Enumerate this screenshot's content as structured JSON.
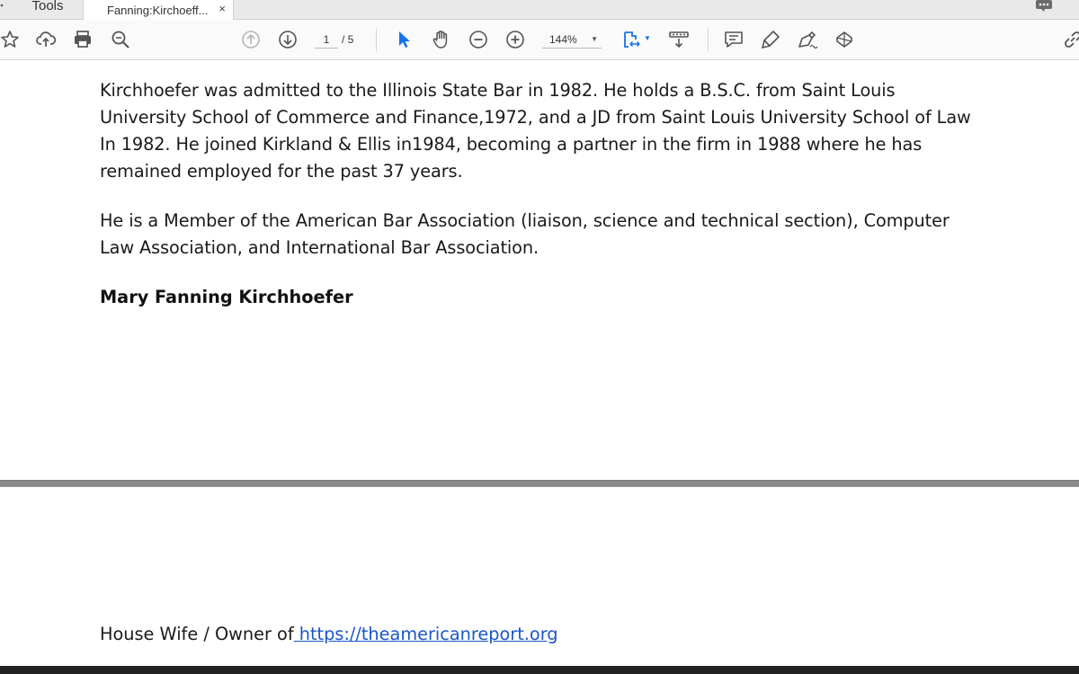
{
  "tabs": {
    "tools_label": "Tools",
    "document_label": "Fanning:Kirchoeff...",
    "close_glyph": "×"
  },
  "toolbar": {
    "icons": [
      "star-icon",
      "cloud-upload-icon",
      "print-icon",
      "search-zoom-icon",
      "page-up-icon",
      "page-down-icon",
      "select-cursor-icon",
      "hand-icon",
      "zoom-out-icon",
      "zoom-in-icon",
      "fit-page-icon",
      "scroll-mode-icon",
      "comment-icon",
      "highlight-icon",
      "sign-icon",
      "stamp-icon",
      "link-icon"
    ],
    "page_current": "1",
    "page_total": "/ 5",
    "zoom_value": "144%",
    "accent_color": "#1473e6"
  },
  "document": {
    "paragraph_1": "Kirchhoefer was admitted to the Illinois State Bar in 1982. He holds a B.S.C. from Saint Louis University School of Commerce and Finance,1972, and a JD from Saint Louis University School of Law In 1982. He joined Kirkland & Ellis in1984, becoming a partner in the firm in 1988 where he has remained employed for the past 37 years.",
    "paragraph_2": "He is a Member of the American Bar Association (liaison, science and technical section), Computer Law Association, and International Bar Association.",
    "name_heading": "Mary Fanning Kirchhoefer",
    "footer_prefix": "House Wife / Owner of",
    "footer_link": " https://theamericanreport.org",
    "link_color": "#1a56c8"
  }
}
